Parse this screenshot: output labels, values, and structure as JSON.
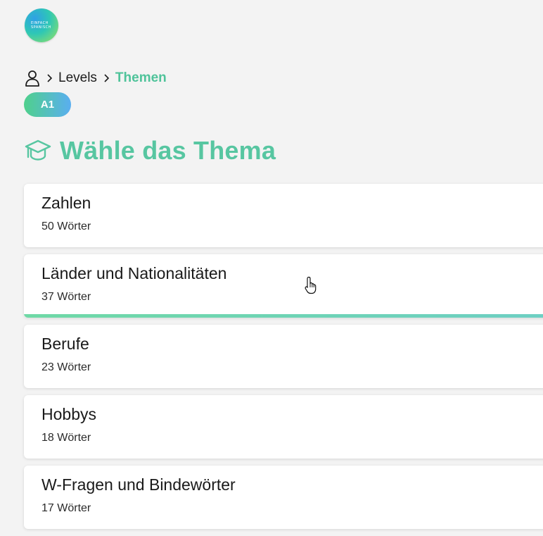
{
  "logo": {
    "text": "EINFACH\nSPANISCH",
    "icon": "circle-logo"
  },
  "breadcrumb": {
    "user_icon": "user-icon",
    "items": [
      "Levels",
      "Themen"
    ]
  },
  "level_badge": {
    "label": "A1"
  },
  "heading": {
    "icon": "graduation-cap-icon",
    "title": "Wähle das Thema"
  },
  "topics": [
    {
      "name": "Zahlen",
      "count": "50 Wörter"
    },
    {
      "name": "Länder und Nationalitäten",
      "count": "37 Wörter"
    },
    {
      "name": "Berufe",
      "count": "23 Wörter"
    },
    {
      "name": "Hobbys",
      "count": "18 Wörter"
    },
    {
      "name": "W-Fragen und Bindewörter",
      "count": "17 Wörter"
    }
  ],
  "colors": {
    "accent": "#57c6a1",
    "badge_gradient_start": "#4fd08c",
    "badge_gradient_end": "#5aaef0",
    "background": "#f3f3f3"
  }
}
